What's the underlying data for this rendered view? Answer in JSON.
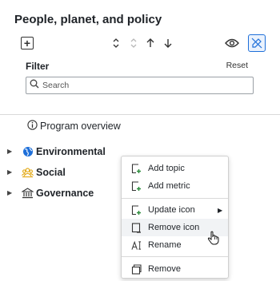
{
  "panel": {
    "title": "People, planet, and policy"
  },
  "toolbar": {
    "icons": [
      "add-box-icon",
      "sort-icon",
      "sort-icon",
      "arrow-up-icon",
      "arrow-down-icon",
      "eye-icon",
      "edit-off-icon"
    ]
  },
  "filter": {
    "label": "Filter",
    "reset_label": "Reset",
    "search_placeholder": "Search",
    "search_value": ""
  },
  "tree": {
    "overview_label": "Program overview",
    "items": [
      {
        "label": "Environmental",
        "icon": "globe-icon"
      },
      {
        "label": "Social",
        "icon": "people-icon"
      },
      {
        "label": "Governance",
        "icon": "institution-icon"
      }
    ]
  },
  "context_menu": {
    "items": [
      {
        "label": "Add topic",
        "icon": "add-topic-icon"
      },
      {
        "label": "Add metric",
        "icon": "add-metric-icon"
      },
      {
        "label": "Update icon",
        "icon": "update-icon-icon",
        "has_submenu": true
      },
      {
        "label": "Remove icon",
        "icon": "remove-icon-icon"
      },
      {
        "label": "Rename",
        "icon": "rename-icon"
      },
      {
        "label": "Remove",
        "icon": "trash-icon"
      }
    ]
  },
  "colors": {
    "accent": "#1e6fd9",
    "social_icon": "#e0a100",
    "text": "#1f2328"
  }
}
